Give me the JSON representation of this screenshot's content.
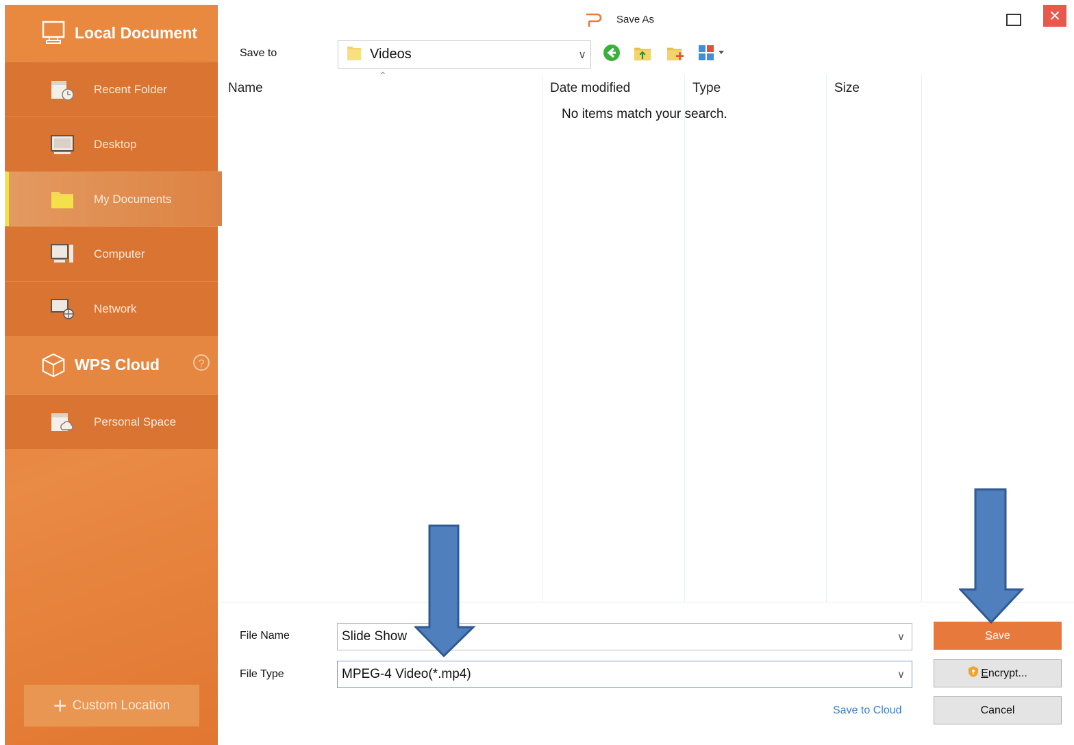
{
  "sidebar": {
    "local_title": "Local Document",
    "items": [
      {
        "label": "Recent Folder"
      },
      {
        "label": "Desktop"
      },
      {
        "label": "My Documents"
      },
      {
        "label": "Computer"
      },
      {
        "label": "Network"
      }
    ],
    "cloud_title": "WPS Cloud",
    "cloud_help": "?",
    "cloud_items": [
      {
        "label": "Personal Space"
      }
    ],
    "custom_location": "Custom Location",
    "active_item": "My Documents",
    "accent_color": "#e07a36",
    "active_marker_color": "#f4e04b"
  },
  "window": {
    "title": "Save As",
    "close_glyph": "×"
  },
  "save_to": {
    "label": "Save to",
    "value": "Videos"
  },
  "file_list": {
    "columns": [
      "Name",
      "Date modified",
      "Type",
      "Size"
    ],
    "empty_message": "No items match your search."
  },
  "form": {
    "file_name_label": "File Name",
    "file_name_value": "Slide Show",
    "file_type_label": "File Type",
    "file_type_value": "MPEG-4 Video(*.mp4)",
    "save_to_cloud": "Save to Cloud"
  },
  "buttons": {
    "save_first": "S",
    "save_rest": "ave",
    "encrypt_first": "E",
    "encrypt_rest": "ncrypt...",
    "cancel": "Cancel",
    "save_color": "#e8793c"
  },
  "annotations": {
    "arrow_color": "#4f7fbd"
  }
}
